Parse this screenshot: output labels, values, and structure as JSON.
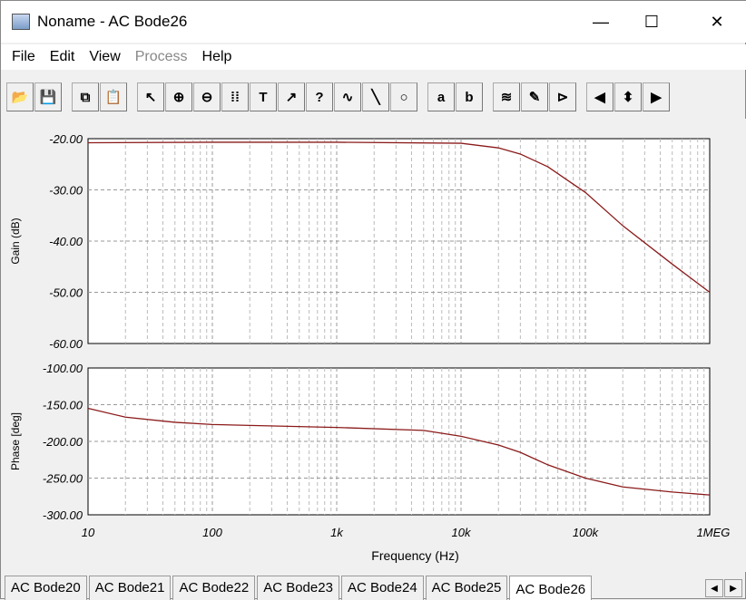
{
  "window": {
    "title": "Noname - AC Bode26",
    "minimize": "—",
    "maximize": "☐",
    "close": "✕"
  },
  "menu": [
    {
      "label": "File",
      "enabled": true
    },
    {
      "label": "Edit",
      "enabled": true
    },
    {
      "label": "View",
      "enabled": true
    },
    {
      "label": "Process",
      "enabled": false
    },
    {
      "label": "Help",
      "enabled": true
    }
  ],
  "toolbar": [
    {
      "icon": "open-folder-icon",
      "glyph": "📂"
    },
    {
      "icon": "save-icon",
      "glyph": "💾"
    },
    null,
    {
      "icon": "copy-icon",
      "glyph": "⧉"
    },
    {
      "icon": "paste-icon",
      "glyph": "📋"
    },
    null,
    {
      "icon": "pointer-icon",
      "glyph": "↖"
    },
    {
      "icon": "zoom-in-icon",
      "glyph": "⊕"
    },
    {
      "icon": "zoom-out-100-icon",
      "glyph": "⊖"
    },
    {
      "icon": "grid-icon",
      "glyph": "⁞⁞"
    },
    {
      "icon": "text-icon",
      "glyph": "T"
    },
    {
      "icon": "label-curve-icon",
      "glyph": "↗"
    },
    {
      "icon": "query-curve-icon",
      "glyph": "?"
    },
    {
      "icon": "formula-curve-icon",
      "glyph": "∿"
    },
    {
      "icon": "line-icon",
      "glyph": "╲"
    },
    {
      "icon": "circle-icon",
      "glyph": "○"
    },
    null,
    {
      "icon": "cursor-a-icon",
      "glyph": "a"
    },
    {
      "icon": "cursor-b-icon",
      "glyph": "b"
    },
    null,
    {
      "icon": "add-curves-icon",
      "glyph": "≋"
    },
    {
      "icon": "eyedropper-icon",
      "glyph": "✎"
    },
    {
      "icon": "marker-icon",
      "glyph": "⊳"
    },
    null,
    {
      "icon": "scroll-left-icon",
      "glyph": "◀"
    },
    {
      "icon": "scroll-updown-icon",
      "glyph": "⬍"
    },
    {
      "icon": "scroll-right-icon",
      "glyph": "▶"
    }
  ],
  "chart_data": [
    {
      "type": "line",
      "ylabel": "Gain (dB)",
      "xscale": "log",
      "xlim": [
        10,
        1000000
      ],
      "ylim": [
        -60,
        -20
      ],
      "yticks": [
        "-20.00",
        "-30.00",
        "-40.00",
        "-50.00",
        "-60.00"
      ],
      "grid": true,
      "color": "#8b1a1a",
      "x": [
        10,
        100,
        1000,
        10000,
        20000,
        30000,
        50000,
        100000,
        200000,
        500000,
        1000000
      ],
      "y": [
        -20.8,
        -20.7,
        -20.7,
        -20.9,
        -21.8,
        -23,
        -25.5,
        -30.5,
        -37,
        -44.5,
        -50
      ]
    },
    {
      "type": "line",
      "ylabel": "Phase [deg]",
      "xlabel": "Frequency (Hz)",
      "xscale": "log",
      "xlim": [
        10,
        1000000
      ],
      "ylim": [
        -300,
        -100
      ],
      "yticks": [
        "-100.00",
        "-150.00",
        "-200.00",
        "-250.00",
        "-300.00"
      ],
      "xticks": [
        "10",
        "100",
        "1k",
        "10k",
        "100k",
        "1MEG"
      ],
      "grid": true,
      "color": "#8b1a1a",
      "x": [
        10,
        20,
        50,
        100,
        1000,
        5000,
        10000,
        20000,
        30000,
        50000,
        100000,
        200000,
        500000,
        1000000
      ],
      "y": [
        -155,
        -167,
        -174,
        -177,
        -181,
        -185,
        -193,
        -205,
        -215,
        -232,
        -250,
        -262,
        -269,
        -273
      ]
    }
  ],
  "tabs": [
    "AC Bode20",
    "AC Bode21",
    "AC Bode22",
    "AC Bode23",
    "AC Bode24",
    "AC Bode25",
    "AC Bode26"
  ],
  "active_tab": "AC Bode26"
}
